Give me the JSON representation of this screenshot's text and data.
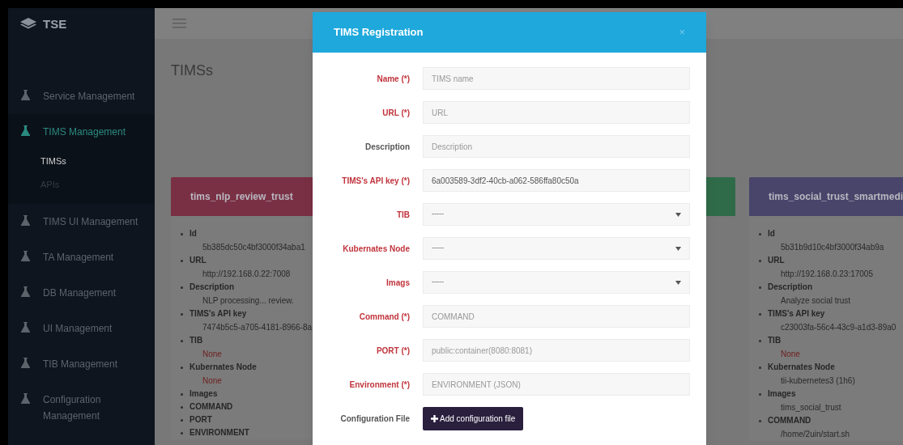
{
  "sidebar": {
    "brand": "TSE",
    "items": [
      {
        "label": "Service Management",
        "selected": false
      },
      {
        "label": "TIMS Management",
        "selected": true,
        "children": [
          {
            "label": "TIMSs",
            "selected": true
          },
          {
            "label": "APIs",
            "selected": false
          }
        ]
      },
      {
        "label": "TIMS UI Management",
        "selected": false
      },
      {
        "label": "TA Management",
        "selected": false
      },
      {
        "label": "DB Management",
        "selected": false
      },
      {
        "label": "UI Management",
        "selected": false
      },
      {
        "label": "TIB Management",
        "selected": false
      },
      {
        "label": "Configuration Management",
        "selected": false
      }
    ]
  },
  "page_title": "TIMSs",
  "cards": [
    {
      "title": "tims_nlp_review_trust",
      "color": "#7a3044",
      "fields": [
        {
          "label": "Id",
          "value": "5b385dc50c4bf3000f34aba1"
        },
        {
          "label": "URL",
          "value": "http://192.168.0.22:7008"
        },
        {
          "label": "Description",
          "value": "NLP processing... review."
        },
        {
          "label": "TIMS's API key",
          "value": "7474b5c5-a705-4181-8966-8a"
        },
        {
          "label": "TIB",
          "value": "None",
          "empty": true
        },
        {
          "label": "Kubernates Node",
          "value": "None",
          "empty": true
        },
        {
          "label": "Images"
        },
        {
          "label": "COMMAND"
        },
        {
          "label": "PORT"
        },
        {
          "label": "ENVIRONMENT"
        }
      ]
    },
    {
      "color": "#2f6b48"
    },
    {
      "title": "tims_social_trust_smartmedi",
      "color": "#49446a",
      "fields": [
        {
          "label": "Id",
          "value": "5b31b9d10c4bf3000f34ab9a"
        },
        {
          "label": "URL",
          "value": "http://192.168.0.23:17005"
        },
        {
          "label": "Description",
          "value": "Analyze social trust"
        },
        {
          "label": "TIMS's API key",
          "value": "c23003fa-56c4-43c9-a1d3-89a0"
        },
        {
          "label": "TIB",
          "value": "None",
          "empty": true
        },
        {
          "label": "Kubernates Node",
          "value": "tii-kubernetes3 (1h6)"
        },
        {
          "label": "Images",
          "value": "tims_social_trust"
        },
        {
          "label": "COMMAND",
          "value": "/home/2uin/start.sh"
        }
      ]
    }
  ],
  "modal": {
    "title": "TIMS Registration",
    "close": "×",
    "fields": [
      {
        "label": "Name (*)",
        "required": true,
        "kind": "input",
        "placeholder": "TIMS name"
      },
      {
        "label": "URL (*)",
        "required": true,
        "kind": "input",
        "placeholder": "URL"
      },
      {
        "label": "Description",
        "required": false,
        "kind": "input",
        "placeholder": "Description"
      },
      {
        "label": "TIMS's API key (*)",
        "required": true,
        "kind": "input",
        "value": "6a003589-3df2-40cb-a062-586ffa80c50a"
      },
      {
        "label": "TIB",
        "required": true,
        "kind": "select",
        "value": "-----"
      },
      {
        "label": "Kubernates Node",
        "required": true,
        "kind": "select",
        "value": "-----"
      },
      {
        "label": "Imags",
        "required": true,
        "kind": "select",
        "value": "-----"
      },
      {
        "label": "Command (*)",
        "required": true,
        "kind": "input",
        "placeholder": "COMMAND"
      },
      {
        "label": "PORT (*)",
        "required": true,
        "kind": "input",
        "placeholder": "public:container(8080:8081)"
      },
      {
        "label": "Environment (*)",
        "required": true,
        "kind": "input",
        "placeholder": "ENVIRONMENT (JSON)"
      },
      {
        "label": "Configuration File",
        "required": false,
        "kind": "file",
        "button": "Add configuration file"
      }
    ]
  }
}
